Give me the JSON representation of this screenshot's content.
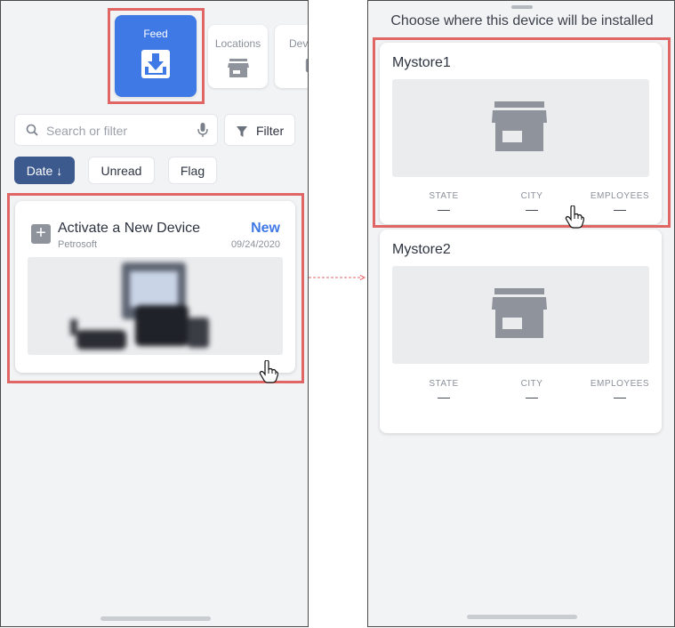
{
  "left_screen": {
    "nav": {
      "feed_label": "Feed",
      "locations_label": "Locations",
      "devices_label": "Dev"
    },
    "search": {
      "placeholder": "Search or filter"
    },
    "filter_label": "Filter",
    "chips": {
      "date": "Date ↓",
      "unread": "Unread",
      "flag": "Flag"
    },
    "feed_card": {
      "title": "Activate a New Device",
      "subtitle": "Petrosoft",
      "badge": "New",
      "date": "09/24/2020"
    }
  },
  "right_screen": {
    "title": "Choose where this device will be installed",
    "stores": [
      {
        "name": "Mystore1",
        "state_label": "STATE",
        "state_value": "—",
        "city_label": "CITY",
        "city_value": "—",
        "employees_label": "EMPLOYEES",
        "employees_value": "—"
      },
      {
        "name": "Mystore2",
        "state_label": "STATE",
        "state_value": "—",
        "city_label": "CITY",
        "city_value": "—",
        "employees_label": "EMPLOYEES",
        "employees_value": "—"
      }
    ]
  },
  "colors": {
    "accent": "#3f79e6",
    "highlight": "#e06666",
    "active_chip": "#3d5a8f",
    "icon_gray": "#8e939c"
  },
  "icons": [
    "download-tray-icon",
    "store-icon",
    "device-icon",
    "search-icon",
    "microphone-icon",
    "funnel-icon",
    "plus-icon",
    "hand-cursor-icon",
    "arrow-icon"
  ]
}
